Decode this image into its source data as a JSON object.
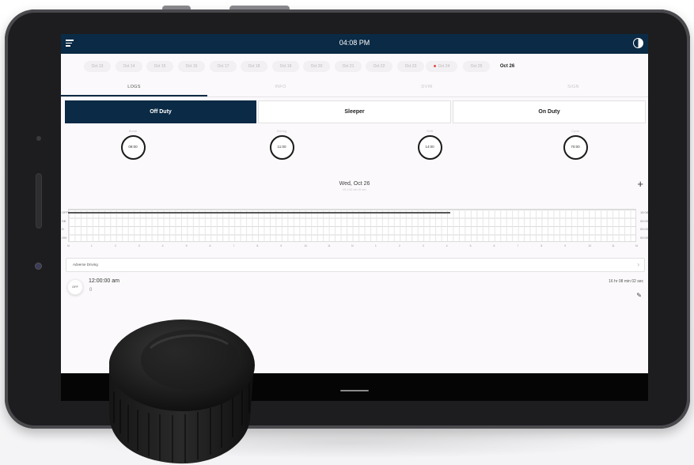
{
  "app": {
    "time": "04:08 PM",
    "icons": {
      "menu": "menu-icon",
      "theme": "contrast-icon",
      "add": "plus-icon",
      "edit": "pencil-icon",
      "chevron": "chevron-right-icon"
    }
  },
  "dates": [
    {
      "label": "Oct 13"
    },
    {
      "label": "Oct 14"
    },
    {
      "label": "Oct 15"
    },
    {
      "label": "Oct 16"
    },
    {
      "label": "Oct 17"
    },
    {
      "label": "Oct 18"
    },
    {
      "label": "Oct 19"
    },
    {
      "label": "Oct 20"
    },
    {
      "label": "Oct 21"
    },
    {
      "label": "Oct 22"
    },
    {
      "label": "Oct 23"
    },
    {
      "label": "Oct 24",
      "violation": true
    },
    {
      "label": "Oct 25"
    },
    {
      "label": "Oct 26",
      "selected": true
    }
  ],
  "tabs": [
    {
      "label": "LOGS",
      "active": true
    },
    {
      "label": "INFO"
    },
    {
      "label": "DVIR"
    },
    {
      "label": "SIGN"
    }
  ],
  "duty_status": [
    {
      "label": "Off Duty",
      "active": true
    },
    {
      "label": "Sleeper"
    },
    {
      "label": "On Duty"
    }
  ],
  "clocks": [
    {
      "label": "Break",
      "value": "08:00"
    },
    {
      "label": "Driving",
      "value": "11:00"
    },
    {
      "label": "Shift",
      "value": "14:00"
    },
    {
      "label": "Cycle",
      "value": "70:00"
    }
  ],
  "day": {
    "title": "Wed, Oct 26",
    "subtitle": "00:1:00 min 00 sec"
  },
  "graph": {
    "rows": [
      "OFF",
      "SB",
      "D",
      "ON"
    ],
    "totals": [
      "16:08",
      "00:00",
      "00:00",
      "00:00"
    ],
    "hours": [
      "M",
      "1",
      "2",
      "3",
      "4",
      "5",
      "6",
      "7",
      "8",
      "9",
      "10",
      "11",
      "N",
      "1",
      "2",
      "3",
      "4",
      "5",
      "6",
      "7",
      "8",
      "9",
      "10",
      "11",
      "M"
    ],
    "off_duty_until_hour": 16.13
  },
  "adverse_driving": {
    "label": "Adverse Driving"
  },
  "log_entry": {
    "status": "OFF",
    "time": "12:00:00 am",
    "location": "0",
    "duration": "16 hr 08 min 02 sec"
  },
  "colors": {
    "primary": "#0a2a45",
    "background": "#fbf9fb",
    "violation": "#e24a4a"
  }
}
